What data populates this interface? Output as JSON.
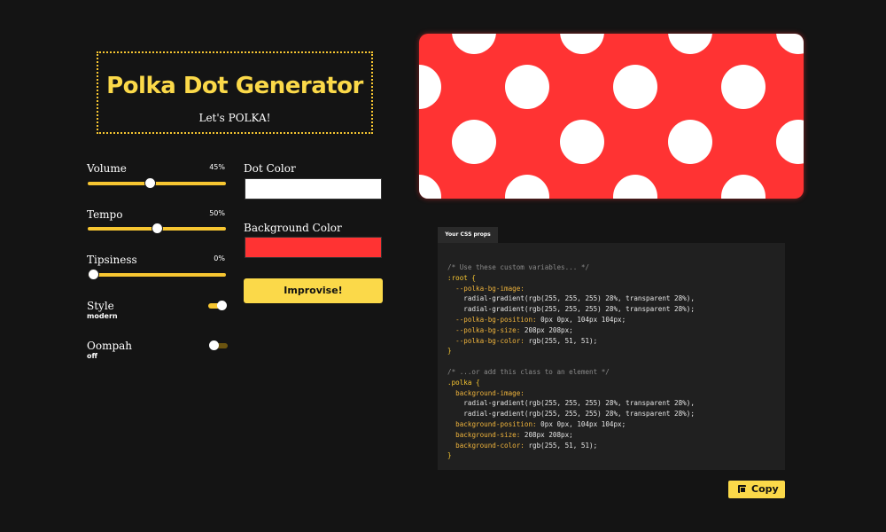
{
  "header": {
    "title": "Polka Dot Generator",
    "subtitle": "Let's POLKA!"
  },
  "sliders": [
    {
      "label": "Volume",
      "value_text": "45%",
      "value": 0.45
    },
    {
      "label": "Tempo",
      "value_text": "50%",
      "value": 0.5
    },
    {
      "label": "Tipsiness",
      "value_text": "0%",
      "value": 0.0
    }
  ],
  "toggles": [
    {
      "label": "Style",
      "value": "modern",
      "on": true
    },
    {
      "label": "Oompah",
      "value": "off",
      "on": false
    }
  ],
  "colors": {
    "dot_label": "Dot Color",
    "dot_value": "#ffffff",
    "background_label": "Background Color",
    "background_value": "#ff3333",
    "accent": "#fbd949"
  },
  "improvise_label": "Improvise!",
  "code": {
    "tab_label": "Your CSS props",
    "comment_vars": "/* Use these custom variables... */",
    "root_selector": ":root {",
    "var_image": "--polka-bg-image:",
    "gradient_line_1": "radial-gradient(rgb(255, 255, 255) 28%, transparent 28%),",
    "gradient_line_2": "radial-gradient(rgb(255, 255, 255) 28%, transparent 28%);",
    "var_position": "--polka-bg-position:",
    "position_value": "0px 0px, 104px 104px;",
    "var_size": "--polka-bg-size:",
    "size_value": "208px 208px;",
    "var_color": "--polka-bg-color:",
    "color_value": "rgb(255, 51, 51);",
    "close": "}",
    "comment_class": "/* ...or add this class to an element */",
    "class_selector": ".polka {",
    "prop_image": "background-image:",
    "prop_position": "background-position:",
    "prop_size": "background-size:",
    "prop_color": "background-color:"
  },
  "copy_label": "Copy"
}
